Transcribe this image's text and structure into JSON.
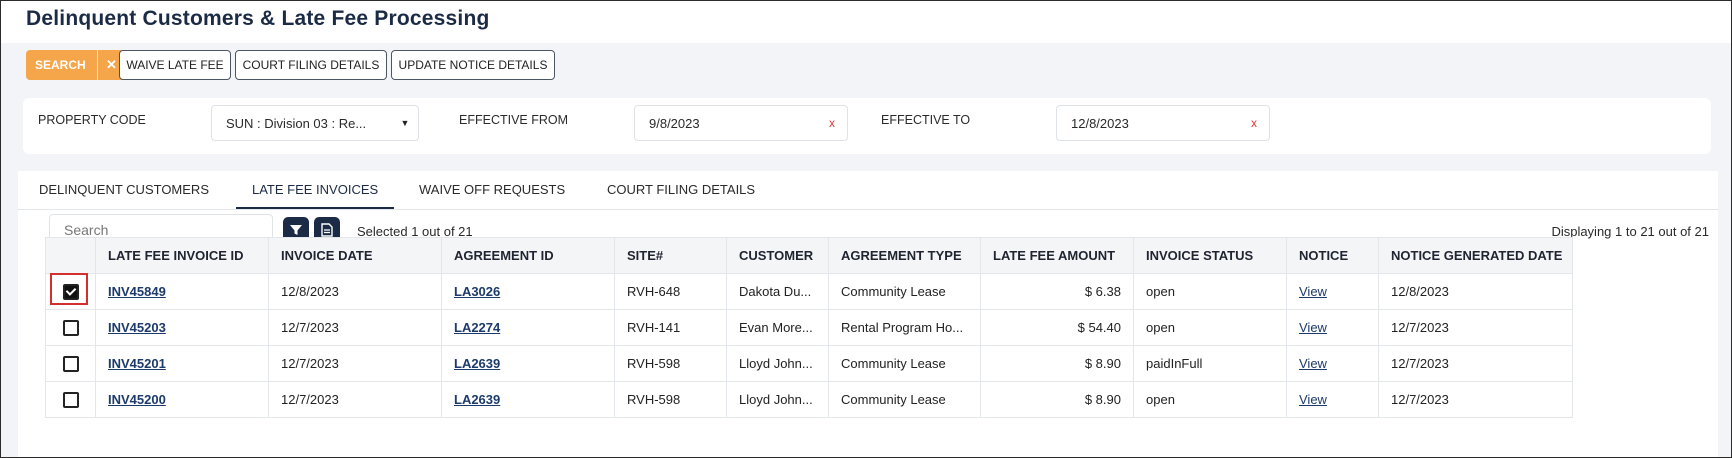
{
  "header": {
    "title": "Delinquent Customers & Late Fee Processing"
  },
  "toolbar": {
    "search_label": "SEARCH",
    "search_clear": "✕",
    "waive_label": "WAIVE LATE FEE",
    "court_label": "COURT FILING DETAILS",
    "notice_label": "UPDATE NOTICE DETAILS"
  },
  "filters": {
    "property_code_label": "PROPERTY CODE",
    "property_code_value": "SUN : Division 03 : Re...",
    "effective_from_label": "EFFECTIVE FROM",
    "effective_from_value": "9/8/2023",
    "effective_to_label": "EFFECTIVE TO",
    "effective_to_value": "12/8/2023",
    "clear_glyph": "x"
  },
  "tabs": [
    {
      "label": "DELINQUENT CUSTOMERS",
      "active": false
    },
    {
      "label": "LATE FEE INVOICES",
      "active": true
    },
    {
      "label": "WAIVE OFF REQUESTS",
      "active": false
    },
    {
      "label": "COURT FILING DETAILS",
      "active": false
    }
  ],
  "grid_tools": {
    "search_placeholder": "Search",
    "selected_text": "Selected 1 out of 21",
    "display_text": "Displaying 1 to 21 out of 21",
    "filter_icon": "filter-icon",
    "export_icon": "export-icon"
  },
  "table": {
    "columns": [
      "LATE FEE INVOICE ID",
      "INVOICE DATE",
      "AGREEMENT ID",
      "SITE#",
      "CUSTOMER",
      "AGREEMENT TYPE",
      "LATE FEE AMOUNT",
      "INVOICE STATUS",
      "NOTICE",
      "NOTICE GENERATED DATE"
    ],
    "rows": [
      {
        "checked": true,
        "invoice_id": "INV45849",
        "invoice_date": "12/8/2023",
        "agreement_id": "LA3026",
        "site": "RVH-648",
        "customer": "Dakota Du...",
        "agreement_type": "Community Lease",
        "amount": "$ 6.38",
        "status": "open",
        "notice": "View",
        "notice_date": "12/8/2023"
      },
      {
        "checked": false,
        "invoice_id": "INV45203",
        "invoice_date": "12/7/2023",
        "agreement_id": "LA2274",
        "site": "RVH-141",
        "customer": "Evan More...",
        "agreement_type": "Rental Program Ho...",
        "amount": "$ 54.40",
        "status": "open",
        "notice": "View",
        "notice_date": "12/7/2023"
      },
      {
        "checked": false,
        "invoice_id": "INV45201",
        "invoice_date": "12/7/2023",
        "agreement_id": "LA2639",
        "site": "RVH-598",
        "customer": "Lloyd John...",
        "agreement_type": "Community Lease",
        "amount": "$ 8.90",
        "status": "paidInFull",
        "notice": "View",
        "notice_date": "12/7/2023"
      },
      {
        "checked": false,
        "invoice_id": "INV45200",
        "invoice_date": "12/7/2023",
        "agreement_id": "LA2639",
        "site": "RVH-598",
        "customer": "Lloyd John...",
        "agreement_type": "Community Lease",
        "amount": "$ 8.90",
        "status": "open",
        "notice": "View",
        "notice_date": "12/7/2023"
      }
    ]
  },
  "colors": {
    "accent": "#f5a54a",
    "navy": "#1c2b45",
    "highlight": "#d32f2f"
  }
}
